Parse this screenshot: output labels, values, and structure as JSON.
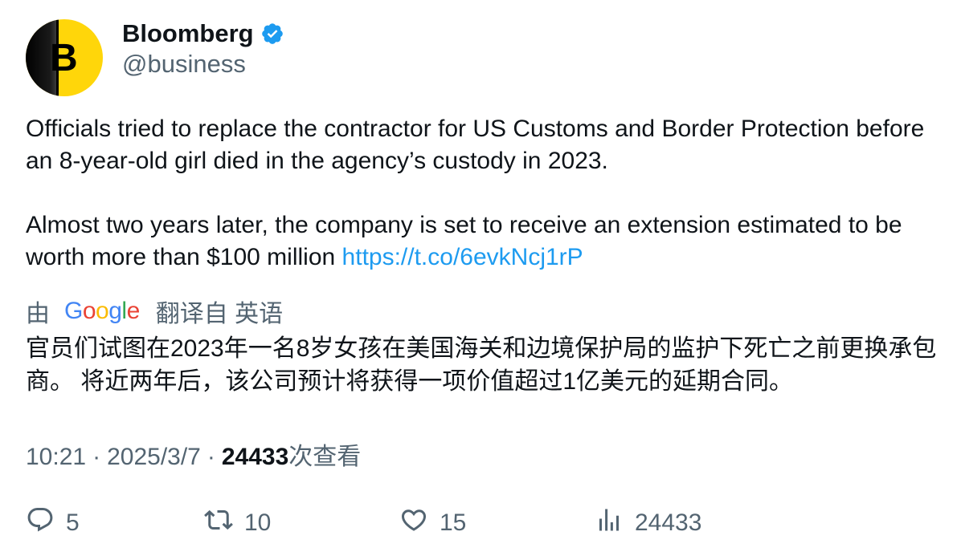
{
  "author": {
    "display_name": "Bloomberg",
    "handle": "@business",
    "avatar_letter": "B",
    "verified": true,
    "verified_color": "#1d9bf0",
    "avatar_color": "#ffd60a"
  },
  "tweet": {
    "paragraph_1": "Officials tried to replace the contractor for US Customs and Border Protection before an 8-year-old girl died in the agency’s custody in 2023.",
    "paragraph_2": "Almost two years later, the company is set to receive an extension estimated to be worth more than $100 million",
    "link_text": "https://t.co/6evkNcj1rP"
  },
  "translation": {
    "by_label": "由",
    "provider": "Google",
    "translated_from": "翻译自 英语",
    "text": "官员们试图在2023年一名8岁女孩在美国海关和边境保护局的监护下死亡之前更换承包商。 将近两年后，该公司预计将获得一项价值超过1亿美元的延期合同。"
  },
  "meta": {
    "time": "10:21",
    "date": "2025/3/7",
    "separator": "·",
    "views_count": "24433",
    "views_label": "次查看"
  },
  "actions": {
    "replies": "5",
    "retweets": "10",
    "likes": "15",
    "views": "24433"
  },
  "colors": {
    "text_primary": "#0f1419",
    "text_secondary": "#536471",
    "link": "#1d9bf0",
    "google_blue": "#4285f4",
    "google_red": "#ea4335",
    "google_yellow": "#fbbc05",
    "google_green": "#34a853"
  },
  "icons": {
    "verified": "verified-badge-icon",
    "reply": "reply-icon",
    "retweet": "retweet-icon",
    "like": "heart-icon",
    "views": "bar-chart-icon"
  }
}
